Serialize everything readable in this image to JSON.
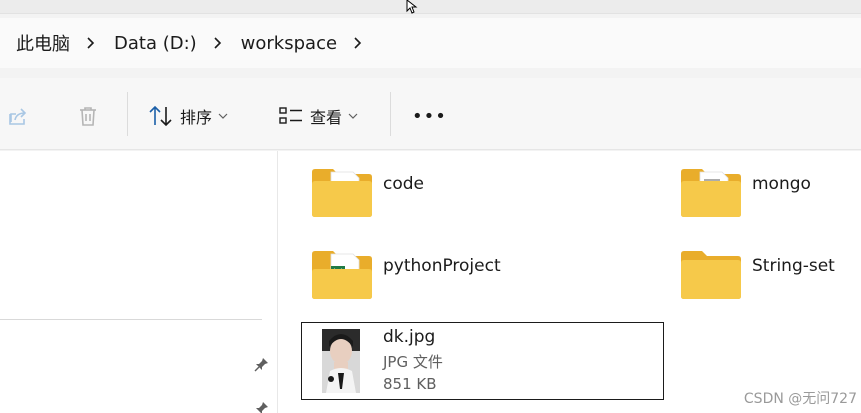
{
  "breadcrumb": {
    "items": [
      "此电脑",
      "Data (D:)",
      "workspace"
    ]
  },
  "toolbar": {
    "sort_label": "排序",
    "view_label": "查看",
    "more_label": "•••"
  },
  "folders": [
    {
      "name": "code"
    },
    {
      "name": "mongo"
    },
    {
      "name": "pythonProject"
    },
    {
      "name": "String-set"
    }
  ],
  "selected_file": {
    "name": "dk.jpg",
    "type": "JPG 文件",
    "size": "851 KB"
  },
  "watermark": "CSDN @无问727",
  "colors": {
    "folder": "#f6c94a",
    "folder_back": "#e9ad2b",
    "selection_border": "#1b1b1b"
  }
}
